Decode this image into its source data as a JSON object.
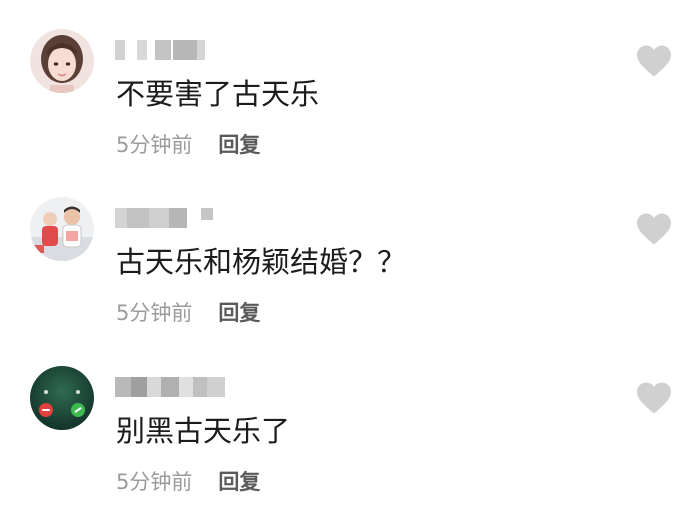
{
  "comments": [
    {
      "avatar_icon": "user-avatar-girl",
      "text": "不要害了古天乐",
      "time": "5分钟前",
      "reply_label": "回复",
      "like_icon": "heart-icon"
    },
    {
      "avatar_icon": "user-avatar-photo",
      "text": "古天乐和杨颖结婚？？",
      "time": "5分钟前",
      "reply_label": "回复",
      "like_icon": "heart-icon"
    },
    {
      "avatar_icon": "user-avatar-call-screen",
      "text": "别黑古天乐了",
      "time": "5分钟前",
      "reply_label": "回复",
      "like_icon": "heart-icon"
    }
  ],
  "colors": {
    "text": "#1c1c1c",
    "meta": "#9b9b9b",
    "reply": "#5a5a5a",
    "heart": "#d0d0d0",
    "blur": "#c9c9c9"
  }
}
